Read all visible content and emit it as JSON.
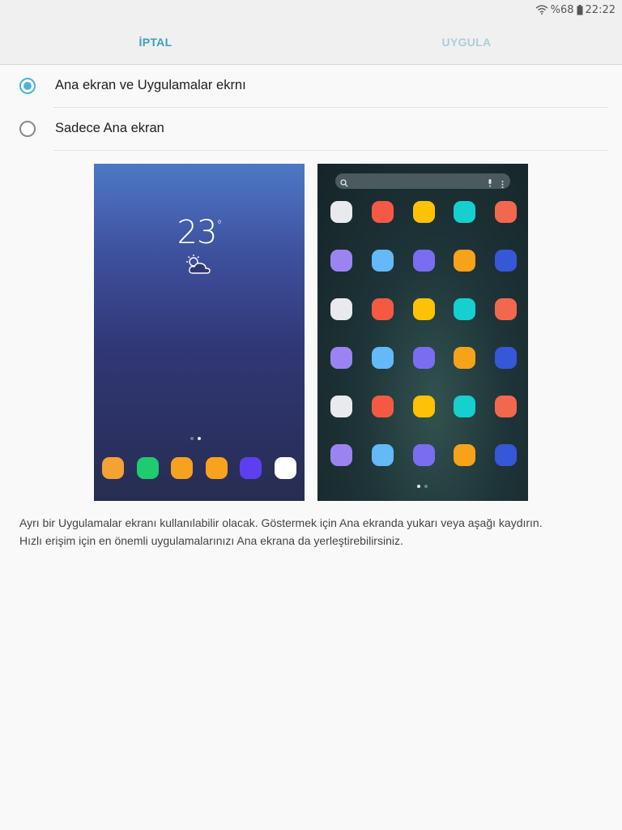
{
  "status_bar": {
    "battery_percent": "%68",
    "time": "22:22",
    "icons": [
      "wifi-icon",
      "battery-icon"
    ]
  },
  "action_bar": {
    "cancel_label": "İPTAL",
    "apply_label": "UYGULA",
    "cancel_color": "#3a9fbf",
    "apply_color_disabled": "#a8cfdc"
  },
  "options": [
    {
      "label": "Ana ekran ve Uygulamalar ekrnı",
      "selected": true
    },
    {
      "label": "Sadece Ana ekran",
      "selected": false
    }
  ],
  "preview_home": {
    "temperature": "23",
    "degree_symbol": "°",
    "weather_icon": "partly-cloudy-icon",
    "dock_colors": [
      "#f4a236",
      "#1ecb6e",
      "#f7a21f",
      "#f8a31e",
      "#5d3ff0",
      "#ffffff"
    ]
  },
  "preview_apps": {
    "search_icons": [
      "search-icon",
      "mic-icon",
      "more-vert-icon"
    ],
    "icon_colors": [
      "#e9eaee",
      "#f45a43",
      "#fdc206",
      "#16cfcf",
      "#f2684f",
      "#9b84f2",
      "#64b9f7",
      "#7a6df0",
      "#f8a21a",
      "#3557d8",
      "#e9eaee",
      "#f45a43",
      "#fdc206",
      "#16cfcf",
      "#f2684f",
      "#9b84f2",
      "#64b9f7",
      "#7a6df0",
      "#f8a21a",
      "#3557d8",
      "#e9eaee",
      "#f45a43",
      "#fdc206",
      "#16cfcf",
      "#f2684f",
      "#9b84f2",
      "#64b9f7",
      "#7a6df0",
      "#f8a21a",
      "#3557d8"
    ]
  },
  "description": {
    "line1": "Ayrı bir Uygulamalar ekranı kullanılabilir olacak. Göstermek için Ana ekranda yukarı veya aşağı kaydırın.",
    "line2": "Hızlı erişim için en önemli uygulamalarınızı Ana ekrana da yerleştirebilirsiniz."
  },
  "colors": {
    "accent": "#4fb2d6",
    "background": "#f9f9f9"
  }
}
